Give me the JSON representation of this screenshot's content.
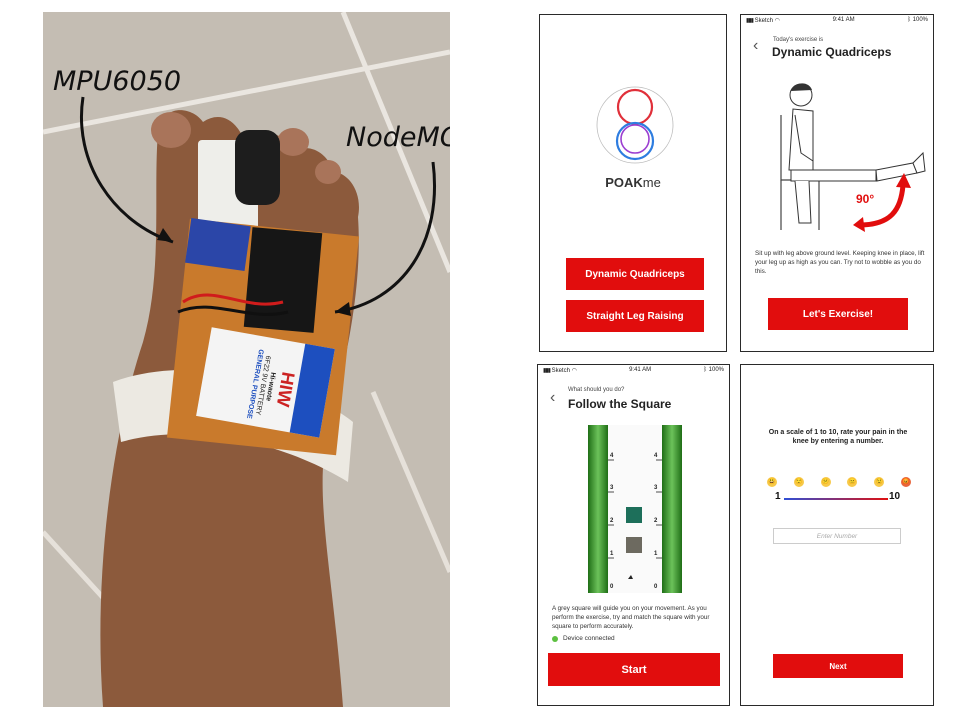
{
  "photo": {
    "label_mpu": "MPU6050",
    "label_node": "NodeMCU",
    "battery_brand": "HIW",
    "battery_sub": "Hi-waote",
    "battery_type": "6F22 9V BATTERY",
    "battery_purpose": "GENERAL PURPOSE"
  },
  "screen_start": {
    "brand_bold": "POAK",
    "brand_light": "me",
    "exercise_1": "Dynamic Quadriceps",
    "exercise_2": "Straight Leg Raising",
    "logo_colors": [
      "#e0303a",
      "#9b3fd1",
      "#2e7de0"
    ]
  },
  "screen_exercise": {
    "status_left": "Sketch",
    "status_time": "9:41 AM",
    "status_battery": "100%",
    "caption": "Today's exercise is",
    "title": "Dynamic Quadriceps",
    "angle": "90°",
    "description": "Sit up with leg above ground level. Keeping knee in place, lift your leg up as high as you can. Try not to wobble as you do this.",
    "cta": "Let's Exercise!"
  },
  "screen_follow": {
    "status_left": "Sketch",
    "status_time": "9:41 AM",
    "status_battery": "100%",
    "caption": "What should you do?",
    "title": "Follow the Square",
    "scale_labels": [
      "4",
      "3",
      "2",
      "1",
      "0"
    ],
    "description": "A grey square will guide you on your movement. As you perform the exercise, try and match the square with your square to perform accurately.",
    "status": "Device connected",
    "cta": "Start"
  },
  "screen_pain": {
    "question": "On a scale of 1 to 10, rate your pain in the knee by entering a number.",
    "emojis": [
      "😃",
      "😌",
      "😕",
      "😐",
      "😟",
      "😡"
    ],
    "scale_min": "1",
    "scale_max": "10",
    "input_placeholder": "Enter Number",
    "cta": "Next"
  },
  "colors": {
    "accent": "#e10d0d",
    "connected": "#5cc040",
    "track_green": "#3a9a2a"
  }
}
